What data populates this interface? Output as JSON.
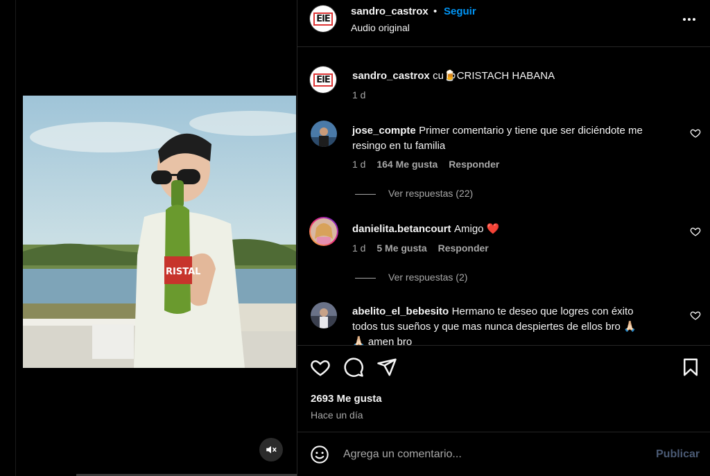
{
  "header": {
    "username": "sandro_castrox",
    "separator": "•",
    "follow_label": "Seguir",
    "audio": "Audio original"
  },
  "caption": {
    "username": "sandro_castrox",
    "text": "cu🍺CRISTACH HABANA",
    "time": "1 d"
  },
  "comments": [
    {
      "username": "jose_compte",
      "text_line1": "Primer comentario y tiene que ser diciéndote me",
      "text_line2": "resingo en tu familia",
      "time": "1 d",
      "likes": "164 Me gusta",
      "reply_label": "Responder",
      "view_replies": "Ver respuestas (22)"
    },
    {
      "username": "danielita.betancourt",
      "text_line1": "Amigo ❤️",
      "time": "1 d",
      "likes": "5 Me gusta",
      "reply_label": "Responder",
      "view_replies": "Ver respuestas (2)"
    },
    {
      "username": "abelito_el_bebesito",
      "text_line1": "Hermano te deseo que logres con éxito",
      "text_line2": "todos tus sueños y que mas nunca despiertes de ellos bro 🙏🏻",
      "text_line3": "🙏🏻 amen bro"
    }
  ],
  "actions": {
    "likes": "2693 Me gusta",
    "time": "Hace un día"
  },
  "add_comment": {
    "placeholder": "Agrega un comentario...",
    "publish_label": "Publicar"
  },
  "icons": {
    "more": "more-horizontal-icon",
    "like": "heart-icon",
    "comment": "comment-bubble-icon",
    "share": "send-paper-plane-icon",
    "save": "bookmark-icon",
    "emoji": "emoji-smiley-icon",
    "mute": "speaker-muted-icon"
  },
  "colors": {
    "background": "#000000",
    "text": "#f5f5f5",
    "secondary_text": "#a8a8a8",
    "link_blue": "#0095f6",
    "border": "#262626"
  }
}
